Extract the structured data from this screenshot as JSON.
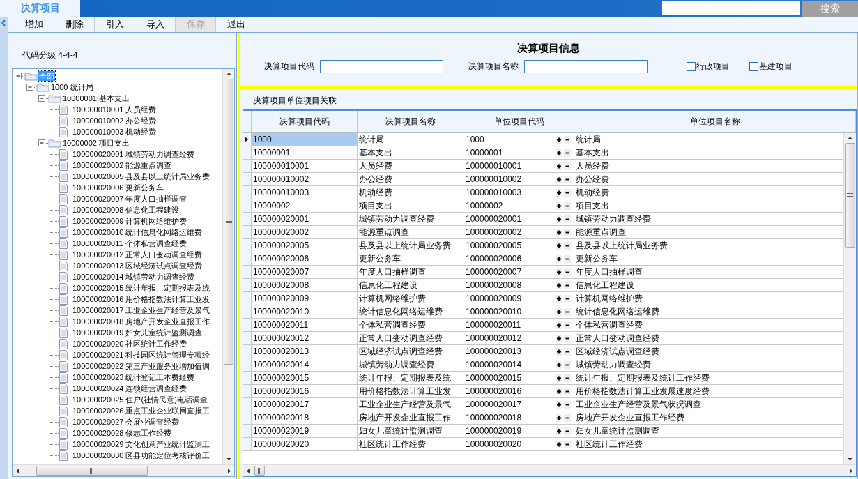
{
  "header_tab": {
    "label": "决算项目"
  },
  "search": {
    "button": "搜索"
  },
  "toolbar": [
    {
      "label": "增加",
      "disabled": false
    },
    {
      "label": "删除",
      "disabled": false
    },
    {
      "label": "引入",
      "disabled": false
    },
    {
      "label": "导入",
      "disabled": false
    },
    {
      "label": "保存",
      "disabled": true
    },
    {
      "label": "退出",
      "disabled": false
    }
  ],
  "tree_panel": {
    "code_levels": "代码分级 4-4-4",
    "tree": [
      {
        "label": "全部",
        "selected": true,
        "expanded": true,
        "children": [
          {
            "label": "1000 统计局",
            "selected": false,
            "expanded": true,
            "children": [
              {
                "label": "10000001 基本支出",
                "selected": false,
                "expanded": true,
                "children": [
                  {
                    "label": "100000010001 人员经费",
                    "selected": false
                  },
                  {
                    "label": "100000010002 办公经费",
                    "selected": false
                  },
                  {
                    "label": "100000010003 机动经费",
                    "selected": false
                  }
                ]
              },
              {
                "label": "10000002 项目支出",
                "selected": false,
                "expanded": true,
                "children": [
                  {
                    "label": "100000020001 城镇劳动力调查经费",
                    "selected": false
                  },
                  {
                    "label": "100000020002 能源重点调查",
                    "selected": false
                  },
                  {
                    "label": "100000020005 县及县以上统计局业务费",
                    "selected": false
                  },
                  {
                    "label": "100000020006 更新公务车",
                    "selected": false
                  },
                  {
                    "label": "100000020007 年度人口抽样调查",
                    "selected": false
                  },
                  {
                    "label": "100000020008 信息化工程建设",
                    "selected": false
                  },
                  {
                    "label": "100000020009 计算机网络维护费",
                    "selected": false
                  },
                  {
                    "label": "100000020010 统计信息化网络运维费",
                    "selected": false
                  },
                  {
                    "label": "100000020011 个体私营调查经费",
                    "selected": false
                  },
                  {
                    "label": "100000020012 正常人口变动调查经费",
                    "selected": false
                  },
                  {
                    "label": "100000020013 区域经济试点调查经费",
                    "selected": false
                  },
                  {
                    "label": "100000020014 城镇劳动力调查经费",
                    "selected": false
                  },
                  {
                    "label": "100000020015 统计年报、定期报表及统",
                    "selected": false
                  },
                  {
                    "label": "100000020016 用价格指数法计算工业发",
                    "selected": false
                  },
                  {
                    "label": "100000020017 工业企业生产经营及景气",
                    "selected": false
                  },
                  {
                    "label": "100000020018 房地产开发企业直报工作",
                    "selected": false
                  },
                  {
                    "label": "100000020019 妇女儿童统计监测调查",
                    "selected": false
                  },
                  {
                    "label": "100000020020 社区统计工作经费",
                    "selected": false
                  },
                  {
                    "label": "100000020021 科技园区统计管理专项经",
                    "selected": false
                  },
                  {
                    "label": "100000020022 第三产业服务业增加值调",
                    "selected": false
                  },
                  {
                    "label": "100000020023 统计登记工本费经费",
                    "selected": false
                  },
                  {
                    "label": "100000020024 连锁经营调查经费",
                    "selected": false
                  },
                  {
                    "label": "100000020025 住户(社情民意)电话调查",
                    "selected": false
                  },
                  {
                    "label": "100000020026 重点工业企业联网直报工",
                    "selected": false
                  },
                  {
                    "label": "100000020027 会展业调查经费",
                    "selected": false
                  },
                  {
                    "label": "100000020028 修志工作经费",
                    "selected": false
                  },
                  {
                    "label": "100000020029 文化创意产业统计监测工",
                    "selected": false
                  },
                  {
                    "label": "100000020030 区县功能定位考核评价工",
                    "selected": false
                  }
                ]
              }
            ]
          }
        ]
      }
    ]
  },
  "info_panel": {
    "title": "决算项目信息",
    "fields": [
      {
        "label": "决算项目代码"
      },
      {
        "label": "决算项目名称"
      }
    ],
    "checkboxes": [
      {
        "label": "行政项目",
        "checked": false
      },
      {
        "label": "基建项目",
        "checked": false
      }
    ]
  },
  "relation_panel": {
    "title": "决算项目单位项目关联",
    "table": {
      "columns": [
        "决算项目代码",
        "决算项目名称",
        "单位项目代码",
        "单位项目名称"
      ],
      "rows": [
        {
          "cells": [
            "1000",
            "统计局",
            "1000",
            "统计局"
          ],
          "selected": true
        },
        {
          "cells": [
            "10000001",
            "基本支出",
            "10000001",
            "基本支出"
          ],
          "selected": false
        },
        {
          "cells": [
            "100000010001",
            "人员经费",
            "100000010001",
            "人员经费"
          ],
          "selected": false
        },
        {
          "cells": [
            "100000010002",
            "办公经费",
            "100000010002",
            "办公经费"
          ],
          "selected": false
        },
        {
          "cells": [
            "100000010003",
            "机动经费",
            "100000010003",
            "机动经费"
          ],
          "selected": false
        },
        {
          "cells": [
            "10000002",
            "项目支出",
            "10000002",
            "项目支出"
          ],
          "selected": false
        },
        {
          "cells": [
            "100000020001",
            "城镇劳动力调查经费",
            "100000020001",
            "城镇劳动力调查经费"
          ],
          "selected": false
        },
        {
          "cells": [
            "100000020002",
            "能源重点调查",
            "100000020002",
            "能源重点调查"
          ],
          "selected": false
        },
        {
          "cells": [
            "100000020005",
            "县及县以上统计局业务费",
            "100000020005",
            "县及县以上统计局业务费"
          ],
          "selected": false
        },
        {
          "cells": [
            "100000020006",
            "更新公务车",
            "100000020006",
            "更新公务车"
          ],
          "selected": false
        },
        {
          "cells": [
            "100000020007",
            "年度人口抽样调查",
            "100000020007",
            "年度人口抽样调查"
          ],
          "selected": false
        },
        {
          "cells": [
            "100000020008",
            "信息化工程建设",
            "100000020008",
            "信息化工程建设"
          ],
          "selected": false
        },
        {
          "cells": [
            "100000020009",
            "计算机网络维护费",
            "100000020009",
            "计算机网络维护费"
          ],
          "selected": false
        },
        {
          "cells": [
            "100000020010",
            "统计信息化网络运维费",
            "100000020010",
            "统计信息化网络运维费"
          ],
          "selected": false
        },
        {
          "cells": [
            "100000020011",
            "个体私营调查经费",
            "100000020011",
            "个体私营调查经费"
          ],
          "selected": false
        },
        {
          "cells": [
            "100000020012",
            "正常人口变动调查经费",
            "100000020012",
            "正常人口变动调查经费"
          ],
          "selected": false
        },
        {
          "cells": [
            "100000020013",
            "区域经济试点调查经费",
            "100000020013",
            "区域经济试点调查经费"
          ],
          "selected": false
        },
        {
          "cells": [
            "100000020014",
            "城镇劳动力调查经费",
            "100000020014",
            "城镇劳动力调查经费"
          ],
          "selected": false
        },
        {
          "cells": [
            "100000020015",
            "统计年报、定期报表及统",
            "100000020015",
            "统计年报、定期报表及统计工作经费"
          ],
          "selected": false
        },
        {
          "cells": [
            "100000020016",
            "用价格指数法计算工业发",
            "100000020016",
            "用价格指数法计算工业发展速度经费"
          ],
          "selected": false
        },
        {
          "cells": [
            "100000020017",
            "工业企业生产经营及景气",
            "100000020017",
            "工业企业生产经营及景气状况调查"
          ],
          "selected": false
        },
        {
          "cells": [
            "100000020018",
            "房地产开发企业直报工作",
            "100000020018",
            "房地产开发企业直报工作经费"
          ],
          "selected": false
        },
        {
          "cells": [
            "100000020019",
            "妇女儿童统计监测调查",
            "100000020019",
            "妇女儿童统计监测调查"
          ],
          "selected": false
        },
        {
          "cells": [
            "100000020020",
            "社区统计工作经费",
            "100000020020",
            "社区统计工作经费"
          ],
          "selected": false
        }
      ]
    }
  }
}
